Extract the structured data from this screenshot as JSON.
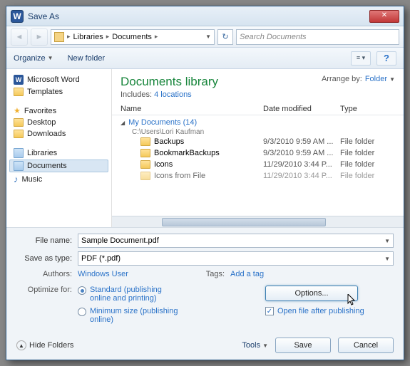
{
  "window": {
    "title": "Save As"
  },
  "nav": {
    "bc1": "Libraries",
    "bc2": "Documents",
    "search_placeholder": "Search Documents"
  },
  "toolbar": {
    "organize": "Organize",
    "newfolder": "New folder"
  },
  "sidebar": {
    "word": "Microsoft Word",
    "templates": "Templates",
    "favorites": "Favorites",
    "desktop": "Desktop",
    "downloads": "Downloads",
    "libraries": "Libraries",
    "documents": "Documents",
    "music": "Music"
  },
  "main": {
    "title": "Documents library",
    "includes_label": "Includes:",
    "includes_link": "4 locations",
    "arrange_label": "Arrange by:",
    "arrange_value": "Folder",
    "col_name": "Name",
    "col_date": "Date modified",
    "col_type": "Type",
    "group_name": "My Documents (14)",
    "group_path": "C:\\Users\\Lori Kaufman",
    "rows": [
      {
        "name": "Backups",
        "date": "9/3/2010 9:59 AM ...",
        "type": "File folder"
      },
      {
        "name": "BookmarkBackups",
        "date": "9/3/2010 9:59 AM ...",
        "type": "File folder"
      },
      {
        "name": "Icons",
        "date": "11/29/2010 3:44 P...",
        "type": "File folder"
      },
      {
        "name": "Icons from File",
        "date": "11/29/2010 3:44 P...",
        "type": "File folder"
      }
    ]
  },
  "form": {
    "filename_label": "File name:",
    "filename_value": "Sample Document.pdf",
    "savetype_label": "Save as type:",
    "savetype_value": "PDF (*.pdf)",
    "authors_label": "Authors:",
    "authors_value": "Windows User",
    "tags_label": "Tags:",
    "tags_value": "Add a tag",
    "optimize_label": "Optimize for:",
    "radio_standard": "Standard (publishing online and printing)",
    "radio_min": "Minimum size (publishing online)",
    "options_btn": "Options...",
    "open_after": "Open file after publishing"
  },
  "footer": {
    "hide": "Hide Folders",
    "tools": "Tools",
    "save": "Save",
    "cancel": "Cancel"
  }
}
